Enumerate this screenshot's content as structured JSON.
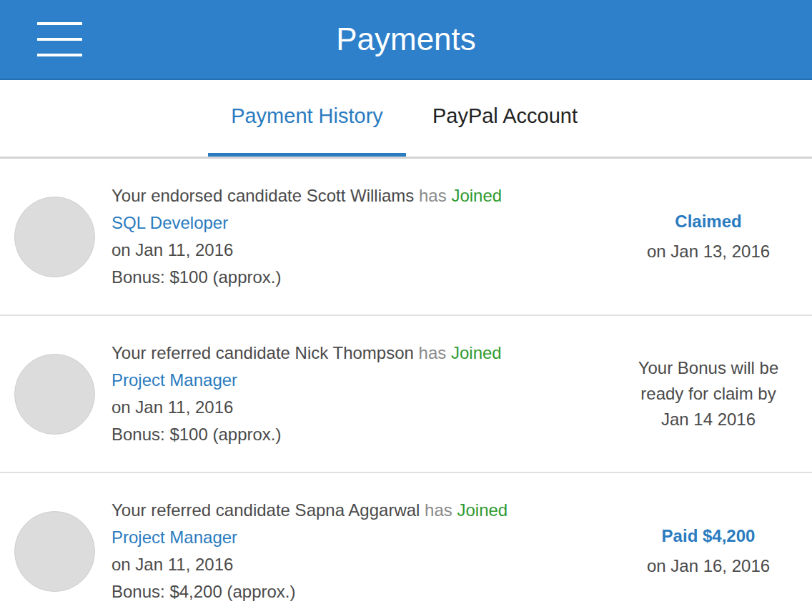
{
  "header": {
    "title": "Payments"
  },
  "tabs": [
    {
      "label": "Payment History",
      "selected": true
    },
    {
      "label": "PayPal Account",
      "selected": false
    }
  ],
  "payments": [
    {
      "kind": "claimed",
      "intro": "Your endorsed candidate Scott Williams",
      "verb": "has",
      "status": "Joined",
      "position": "SQL Developer",
      "date": "on Jan 11, 2016",
      "bonus": "Bonus: $100 (approx.)",
      "result_title": "Claimed",
      "result_lines": [
        "on Jan 13, 2016"
      ]
    },
    {
      "kind": "pending",
      "intro": "Your referred candidate Nick Thompson",
      "verb": "has",
      "status": "Joined",
      "position": "Project Manager",
      "date": "on Jan 11, 2016",
      "bonus": "Bonus: $100 (approx.)",
      "result_title": "",
      "result_lines": [
        "Your Bonus will be",
        "ready for claim by",
        "Jan 14 2016"
      ]
    },
    {
      "kind": "paid",
      "intro": "Your referred candidate Sapna Aggarwal",
      "verb": "has",
      "status": "Joined",
      "position": "Project Manager",
      "date": "on Jan 11, 2016",
      "bonus": "Bonus: $4,200 (approx.)",
      "result_title": "Paid $4,200",
      "result_lines": [
        "on Jan 16, 2016"
      ]
    }
  ]
}
